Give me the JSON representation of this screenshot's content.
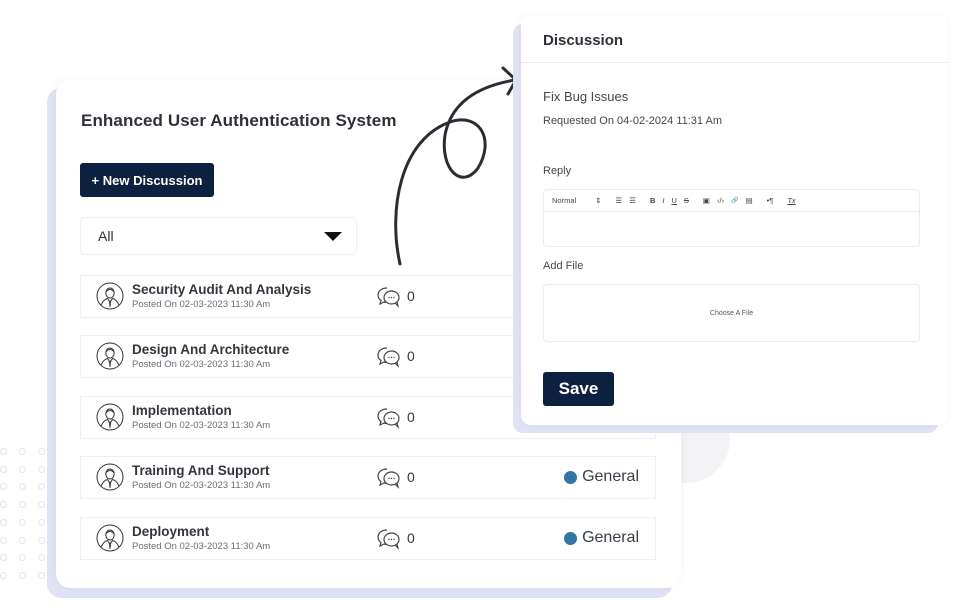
{
  "project": {
    "title": "Enhanced User Authentication System",
    "new_discussion_label": "+ New Discussion",
    "filter": {
      "selected": "All"
    }
  },
  "discussions": [
    {
      "title": "Security Audit And Analysis",
      "posted": "Posted On 02-03-2023 11:30 Am",
      "comments": "0",
      "category": ""
    },
    {
      "title": "Design And Architecture",
      "posted": "Posted On 02-03-2023 11:30 Am",
      "comments": "0",
      "category": ""
    },
    {
      "title": "Implementation",
      "posted": "Posted On 02-03-2023 11:30 Am",
      "comments": "0",
      "category": ""
    },
    {
      "title": "Training And Support",
      "posted": "Posted On 02-03-2023 11:30 Am",
      "comments": "0",
      "category": "General"
    },
    {
      "title": "Deployment",
      "posted": "Posted On 02-03-2023 11:30 Am",
      "comments": "0",
      "category": "General"
    }
  ],
  "dialog": {
    "title": "Discussion",
    "discussion_name": "Fix Bug Issues",
    "requested": "Requested On 04-02-2024 11:31 Am",
    "reply_label": "Reply",
    "toolbar": {
      "format": "Normal",
      "format_arrow": "⇕",
      "ordered_list": "☰",
      "bullet_list": "☰",
      "bold": "B",
      "italic": "I",
      "underline": "U",
      "strike": "S",
      "image": "▣",
      "code": "‹/›",
      "link": "🔗",
      "video": "▤",
      "direction": "•¶",
      "clear": "Tx"
    },
    "add_file_label": "Add File",
    "choose_file": "Choose A File",
    "save_label": "Save"
  },
  "colors": {
    "primary": "#0c203f",
    "category_general": "#2e76a6",
    "card_shadow": "#dfe3f5"
  }
}
